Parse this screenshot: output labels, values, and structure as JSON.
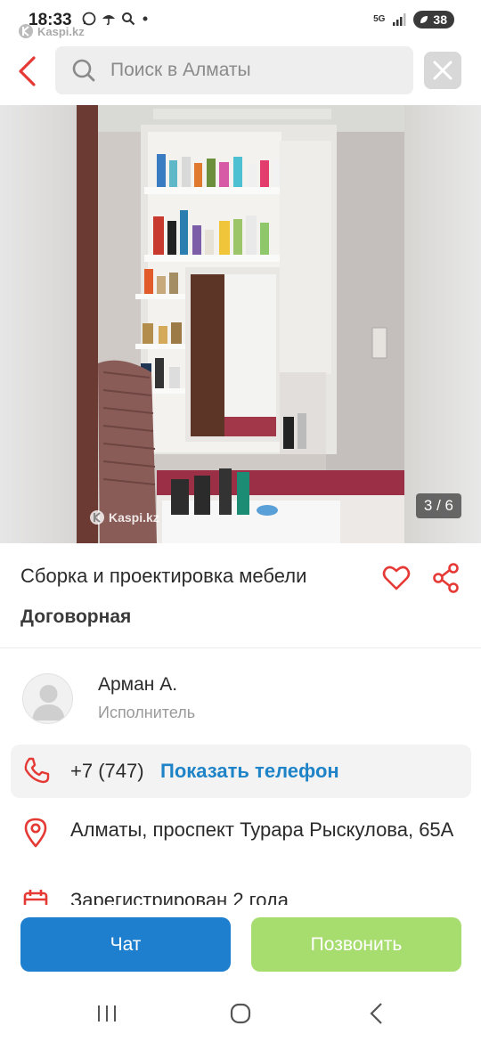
{
  "status_bar": {
    "time": "18:33",
    "network": "5G",
    "battery": "38",
    "app_mark": "Kaspi.kz"
  },
  "search": {
    "placeholder": "Поиск в Алматы"
  },
  "gallery": {
    "counter": "3 / 6",
    "watermark": "Kaspi.kz"
  },
  "listing": {
    "title": "Сборка и проектировка мебели",
    "price": "Договорная"
  },
  "author": {
    "name": "Арман А.",
    "role": "Исполнитель"
  },
  "contact": {
    "phone_prefix": "+7 (747)",
    "show_phone_label": "Показать телефон",
    "address": "Алматы, проспект Турара Рыскулова, 65А",
    "registered": "Зарегистрирован 2 года"
  },
  "actions": {
    "chat_label": "Чат",
    "call_label": "Позвонить"
  },
  "colors": {
    "accent_red": "#e53935",
    "link_blue": "#1e83c7",
    "chat_blue": "#1e7fce",
    "call_green": "#a7dc6f"
  }
}
